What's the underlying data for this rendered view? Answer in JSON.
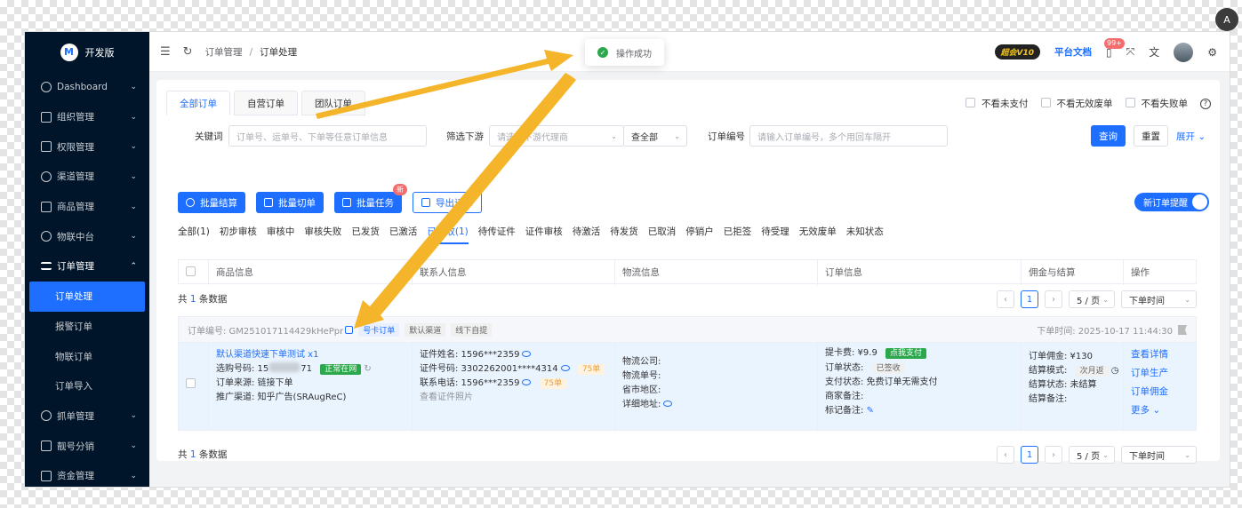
{
  "sidebar": {
    "logo_letter": "M",
    "logo_text": "开发版",
    "items": [
      {
        "label": "Dashboard"
      },
      {
        "label": "组织管理"
      },
      {
        "label": "权限管理"
      },
      {
        "label": "渠道管理"
      },
      {
        "label": "商品管理"
      },
      {
        "label": "物联中台"
      },
      {
        "label": "订单管理"
      }
    ],
    "subitems": [
      {
        "label": "订单处理"
      },
      {
        "label": "报警订单"
      },
      {
        "label": "物联订单"
      },
      {
        "label": "订单导入"
      }
    ],
    "items_after": [
      {
        "label": "抓单管理"
      },
      {
        "label": "靓号分销"
      },
      {
        "label": "资金管理"
      }
    ]
  },
  "header": {
    "breadcrumb": [
      "订单管理",
      "订单处理"
    ],
    "vip_label": "超会V10",
    "doc_link": "平台文档",
    "notify_count": "99+"
  },
  "toast": {
    "text": "操作成功"
  },
  "tabs": [
    "全部订单",
    "自营订单",
    "团队订单"
  ],
  "checks": [
    "不看未支付",
    "不看无效废单",
    "不看失败单"
  ],
  "filters": {
    "keyword_label": "关键词",
    "keyword_placeholder": "订单号、运单号、下单等任意订单信息",
    "downstream_label": "筛选下游",
    "downstream_placeholder": "请选择下游代理商",
    "scope_value": "查全部",
    "order_no_label": "订单编号",
    "order_no_placeholder": "请输入订单编号，多个用回车隔开",
    "search": "查询",
    "reset": "重置",
    "expand": "展开"
  },
  "actions": {
    "batch_settle": "批量结算",
    "batch_cut": "批量切单",
    "batch_task": "批量任务",
    "new_badge": "新",
    "export": "导出订单",
    "new_order_toggle": "新订单提醒"
  },
  "status_tabs": [
    "全部(1)",
    "初步审核",
    "审核中",
    "审核失败",
    "已发货",
    "已激活",
    "已签收(1)",
    "待传证件",
    "证件审核",
    "待激活",
    "待发货",
    "已取消",
    "停销户",
    "已拒签",
    "待受理",
    "无效废单",
    "未知状态"
  ],
  "active_status": "已签收(1)",
  "table": {
    "headers": [
      "商品信息",
      "联系人信息",
      "物流信息",
      "订单信息",
      "佣金与结算",
      "操作"
    ]
  },
  "summary": {
    "prefix": "共",
    "count": "1",
    "suffix": "条数据"
  },
  "pager": {
    "page": "1",
    "size": "5 / 页",
    "sort": "下单时间"
  },
  "order": {
    "order_no": "订单编号: GM251017114429kHePpr",
    "tags": [
      "号卡订单",
      "默认渠道",
      "线下自提"
    ],
    "time": "下单时间: 2025-10-17 11:44:30",
    "product": {
      "name": "默认渠道快速下单测试 x1",
      "number_prefix": "选购号码: 15",
      "number_suffix": "71",
      "number_status": "正常在网",
      "source": "订单来源: 链接下单",
      "channel": "推广渠道: 知乎广告(SRAugReC)"
    },
    "contact": {
      "name": "证件姓名: 1596***2359",
      "id_no": "证件号码: 3302262001****4314",
      "id_count": "75单",
      "phone": "联系电话: 1596***2359",
      "phone_count": "75单",
      "photo": "查看证件照片"
    },
    "logistics": {
      "company": "物流公司:",
      "tracking": "物流单号:",
      "region": "省市地区:",
      "address": "详细地址:"
    },
    "info": {
      "fee": "提卡费: ¥9.9",
      "fee_tag": "点我支付",
      "state_label": "订单状态:",
      "state": "已签收",
      "pay": "支付状态: 免费订单无需支付",
      "merchant_note": "商家备注:",
      "mark_note": "标记备注:"
    },
    "commission": {
      "amount": "订单佣金: ¥130",
      "mode_label": "结算模式:",
      "mode": "次月返",
      "status": "结算状态: 未结算",
      "note": "结算备注:"
    },
    "ops": [
      "查看详情",
      "订单生产",
      "订单佣金",
      "更多"
    ]
  }
}
